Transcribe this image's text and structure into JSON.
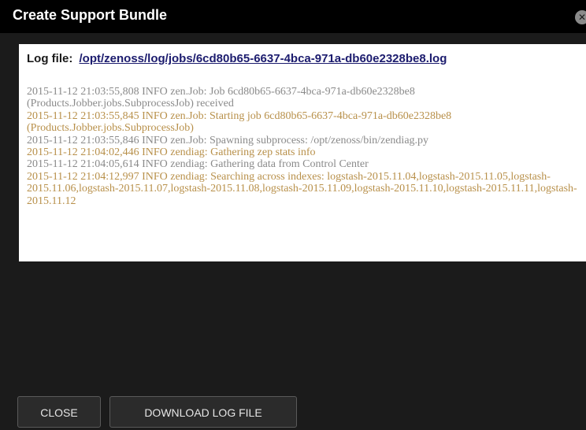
{
  "dialog": {
    "title": "Create Support Bundle",
    "close_icon": "close-icon"
  },
  "logfile": {
    "label": "Log file:",
    "path": "/opt/zenoss/log/jobs/6cd80b65-6637-4bca-971a-db60e2328be8.log"
  },
  "log": {
    "lines": [
      {
        "text": "2015-11-12 21:03:55,808 INFO zen.Job: Job 6cd80b65-6637-4bca-971a-db60e2328be8 (Products.Jobber.jobs.SubprocessJob) received",
        "color": "#8a8a8a"
      },
      {
        "text": "2015-11-12 21:03:55,845 INFO zen.Job: Starting job 6cd80b65-6637-4bca-971a-db60e2328be8 (Products.Jobber.jobs.SubprocessJob)",
        "color": "#b8904a"
      },
      {
        "text": "2015-11-12 21:03:55,846 INFO zen.Job: Spawning subprocess: /opt/zenoss/bin/zendiag.py",
        "color": "#8a8a8a"
      },
      {
        "text": "2015-11-12 21:04:02,446 INFO zendiag: Gathering zep stats info",
        "color": "#b8904a"
      },
      {
        "text": "2015-11-12 21:04:05,614 INFO zendiag: Gathering data from Control Center",
        "color": "#8a8a8a"
      },
      {
        "text": "2015-11-12 21:04:12,997 INFO zendiag: Searching across indexes: logstash-2015.11.04,logstash-2015.11.05,logstash-2015.11.06,logstash-2015.11.07,logstash-2015.11.08,logstash-2015.11.09,logstash-2015.11.10,logstash-2015.11.11,logstash-2015.11.12",
        "color": "#b8904a"
      }
    ]
  },
  "buttons": {
    "close_label": "CLOSE",
    "download_label": "DOWNLOAD LOG FILE"
  },
  "colors": {
    "titlebar": "#000000",
    "body": "#1b1b1b",
    "panel": "#ffffff",
    "log_gray": "#8a8a8a",
    "log_gold": "#b8904a",
    "link": "#1c1c6e"
  }
}
